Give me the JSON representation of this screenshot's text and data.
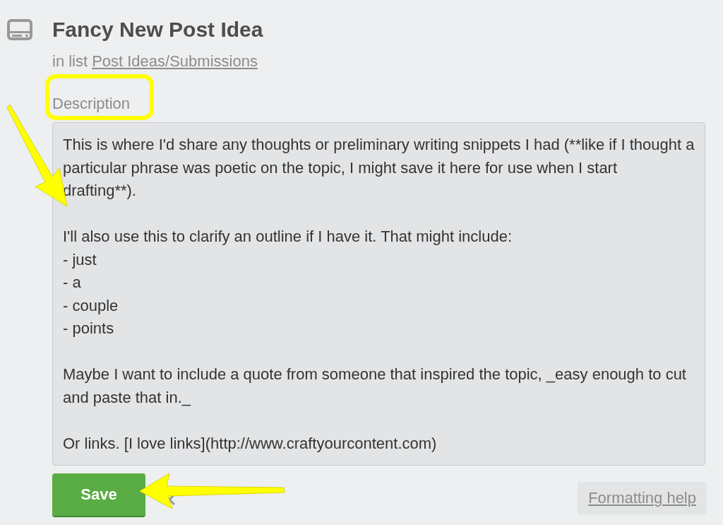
{
  "card": {
    "title": "Fancy New Post Idea",
    "list_prefix": "in list",
    "list_link": "Post Ideas/Submissions"
  },
  "description": {
    "label": "Description",
    "value": "This is where I'd share any thoughts or preliminary writing snippets I had (**like if I thought a particular phrase was poetic on the topic, I might save it here for use when I start drafting**).\n\nI'll also use this to clarify an outline if I have it. That might include:\n- just\n- a\n- couple\n- points\n\nMaybe I want to include a quote from someone that inspired the topic, _easy enough to cut and paste that in._\n\nOr links. [I love links](http://www.craftyourcontent.com)"
  },
  "buttons": {
    "save": "Save",
    "formatting_help": "Formatting help"
  }
}
